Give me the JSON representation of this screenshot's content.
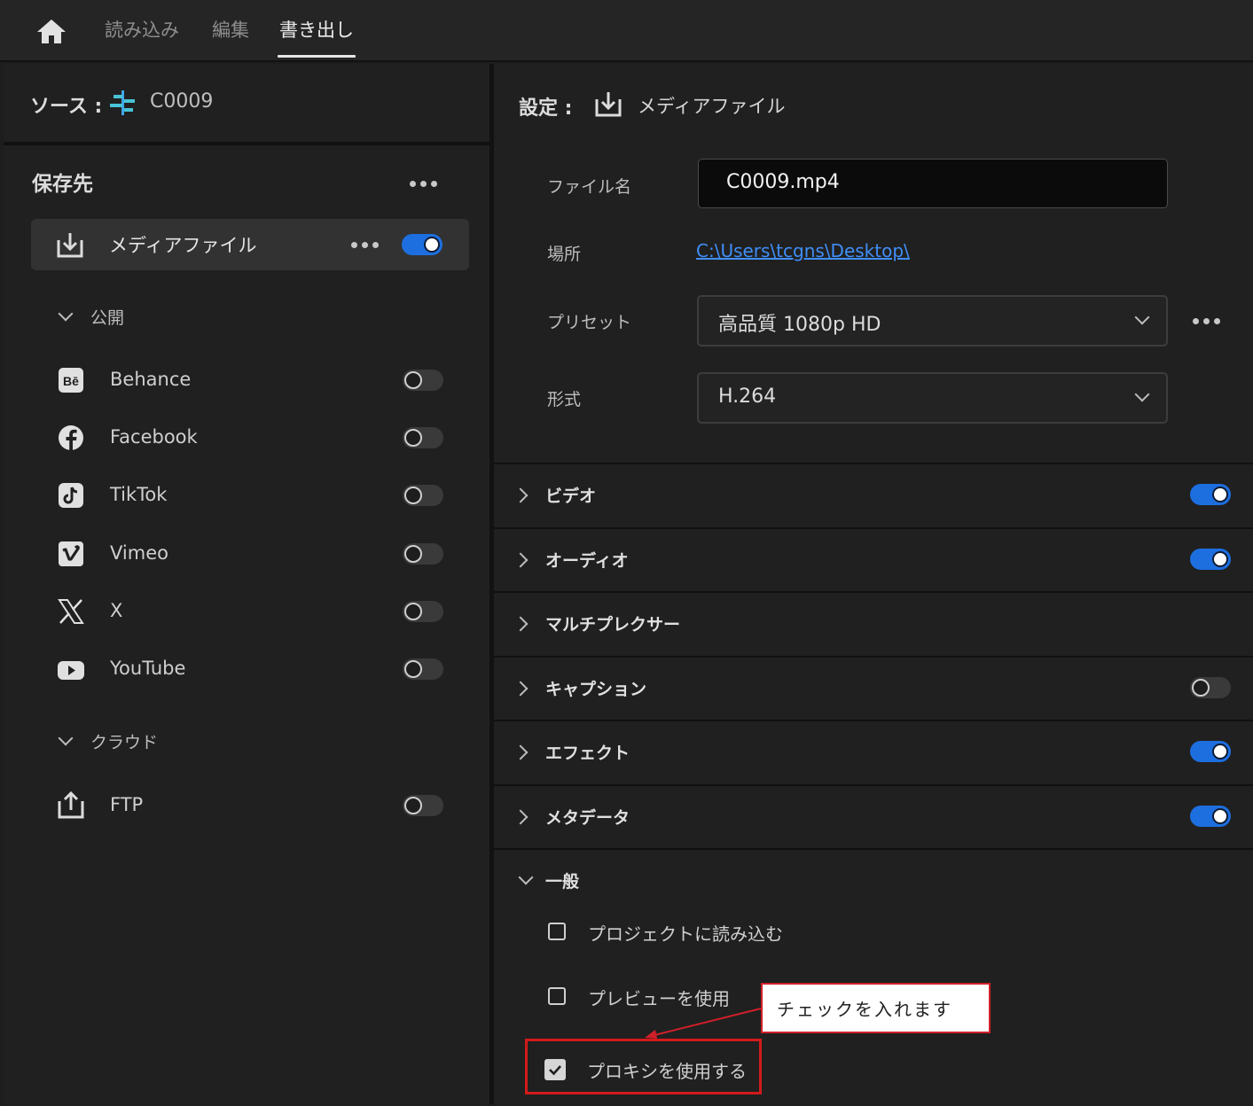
{
  "topbar": {
    "tabs": [
      {
        "label": "読み込み",
        "active": false
      },
      {
        "label": "編集",
        "active": false
      },
      {
        "label": "書き出し",
        "active": true
      }
    ]
  },
  "source": {
    "label": "ソース :",
    "clip": "C0009"
  },
  "destination": {
    "heading": "保存先",
    "media_file": {
      "label": "メディアファイル",
      "enabled": true
    },
    "publish_group": {
      "label": "公開",
      "services": [
        {
          "name": "Behance",
          "icon": "behance-icon",
          "enabled": false
        },
        {
          "name": "Facebook",
          "icon": "facebook-icon",
          "enabled": false
        },
        {
          "name": "TikTok",
          "icon": "tiktok-icon",
          "enabled": false
        },
        {
          "name": "Vimeo",
          "icon": "vimeo-icon",
          "enabled": false
        },
        {
          "name": "X",
          "icon": "x-icon",
          "enabled": false
        },
        {
          "name": "YouTube",
          "icon": "youtube-icon",
          "enabled": false
        }
      ]
    },
    "cloud_group": {
      "label": "クラウド",
      "services": [
        {
          "name": "FTP",
          "icon": "ftp-upload-icon",
          "enabled": false
        }
      ]
    }
  },
  "settings": {
    "label": "設定 :",
    "target": "メディアファイル",
    "filename": {
      "label": "ファイル名",
      "value": "C0009.mp4"
    },
    "location": {
      "label": "場所",
      "value": "C:\\Users\\tcgns\\Desktop\\"
    },
    "preset": {
      "label": "プリセット",
      "value": "高品質 1080p HD"
    },
    "format": {
      "label": "形式",
      "value": "H.264"
    },
    "sections": [
      {
        "label": "ビデオ",
        "toggle": true
      },
      {
        "label": "オーディオ",
        "toggle": true
      },
      {
        "label": "マルチプレクサー",
        "toggle": null
      },
      {
        "label": "キャプション",
        "toggle": false
      },
      {
        "label": "エフェクト",
        "toggle": true
      },
      {
        "label": "メタデータ",
        "toggle": true
      }
    ],
    "general": {
      "label": "一般",
      "options": [
        {
          "label": "プロジェクトに読み込む",
          "checked": false
        },
        {
          "label": "プレビューを使用",
          "checked": false
        },
        {
          "label": "プロキシを使用する",
          "checked": true
        }
      ]
    }
  },
  "annotation": {
    "text": "チェックを入れます",
    "color": "#d0202a"
  },
  "colors": {
    "accent": "#1d6fe0",
    "link": "#3f8ef7",
    "background": "#1d1d1d"
  }
}
